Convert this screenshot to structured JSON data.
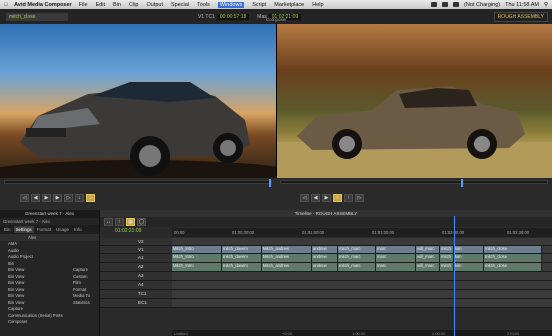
{
  "menubar": {
    "app": "Avid Media Composer",
    "items": [
      "File",
      "Edit",
      "Bin",
      "Clip",
      "Output",
      "Special",
      "Tools",
      "Windows",
      "Script",
      "Marketplace",
      "Help"
    ],
    "battery": "(Not Charging)",
    "clock": "Thu 11:58 AM"
  },
  "composer": {
    "title": "Composer",
    "clip_name": "mitch_close",
    "v1_label": "V1 TC1",
    "v1_tc": "00:00:57:18",
    "mas_label": "Mas",
    "mas_tc": "01:02:21:09",
    "project": "ROUGH ASSEMBLY"
  },
  "bin": {
    "title": "Greenstart week 7 - Alex",
    "subtitle": "Greenstart week 7 - Alex",
    "tabs": [
      "Bin",
      "Settings",
      "Format",
      "Usage",
      "Info"
    ],
    "header": "Alex",
    "rows": [
      [
        "AMA",
        ""
      ],
      [
        "Audio",
        ""
      ],
      [
        "Audio Project",
        ""
      ],
      [
        "Bin",
        ""
      ],
      [
        "Bin View",
        "Capture"
      ],
      [
        "Bin View",
        "Custom"
      ],
      [
        "Bin View",
        "Film"
      ],
      [
        "Bin View",
        "Format"
      ],
      [
        "Bin View",
        "Media To"
      ],
      [
        "Bin View",
        "Statistics"
      ],
      [
        "Capture",
        ""
      ],
      [
        "Communication (Serial) Ports",
        ""
      ],
      [
        "Composer",
        ""
      ]
    ]
  },
  "timeline": {
    "title": "Timeline - ROUGH ASSEMBLY",
    "timecode": "01:02:21:09",
    "ruler": [
      "00:00",
      "01:00:30:00",
      "01:01:00:00",
      "01:01:30:00",
      "01:02:00:00",
      "01:02:30:00"
    ],
    "tracks": [
      "V2",
      "V1",
      "A1",
      "A2",
      "A3",
      "A4",
      "TC1",
      "EC1"
    ],
    "clips": [
      "Mitch_Intro",
      "mitch_davem",
      "Mitch_andrew",
      "andrew",
      "mitch_marc",
      "marc",
      "will_marc",
      "mitch",
      "kim",
      "mitch_close"
    ],
    "footer": [
      "+0:00",
      "1:00:00",
      "2:00:00",
      "270:00"
    ],
    "foot_label": "Untitled"
  }
}
